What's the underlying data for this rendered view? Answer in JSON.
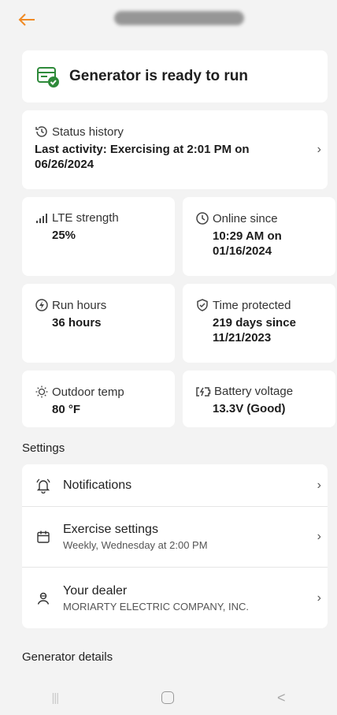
{
  "header": {
    "back_icon": "arrow-left-icon",
    "accent": "#f08a24"
  },
  "ready": {
    "text": "Generator is ready to run",
    "icon": "generator-check-icon"
  },
  "status_history": {
    "label": "Status history",
    "value": "Last activity: Exercising at 2:01 PM on 06/26/2024"
  },
  "tiles": {
    "lte": {
      "label": "LTE strength",
      "value": "25%"
    },
    "online": {
      "label": "Online since",
      "value": "10:29 AM on 01/16/2024"
    },
    "run": {
      "label": "Run hours",
      "value": "36 hours"
    },
    "protected": {
      "label": "Time protected",
      "value": "219 days since 11/21/2023"
    },
    "temp": {
      "label": "Outdoor temp",
      "value": "80 °F"
    },
    "battery": {
      "label": "Battery voltage",
      "value": "13.3V (Good)"
    }
  },
  "settings": {
    "section_label": "Settings",
    "items": [
      {
        "title": "Notifications",
        "sub": ""
      },
      {
        "title": "Exercise settings",
        "sub": "Weekly, Wednesday at 2:00 PM"
      },
      {
        "title": "Your dealer",
        "sub": "MORIARTY ELECTRIC COMPANY, INC."
      }
    ]
  },
  "details": {
    "section_label": "Generator details"
  },
  "chevron": "›",
  "navbar": {
    "recents": "|||",
    "home": "",
    "back": "<"
  }
}
